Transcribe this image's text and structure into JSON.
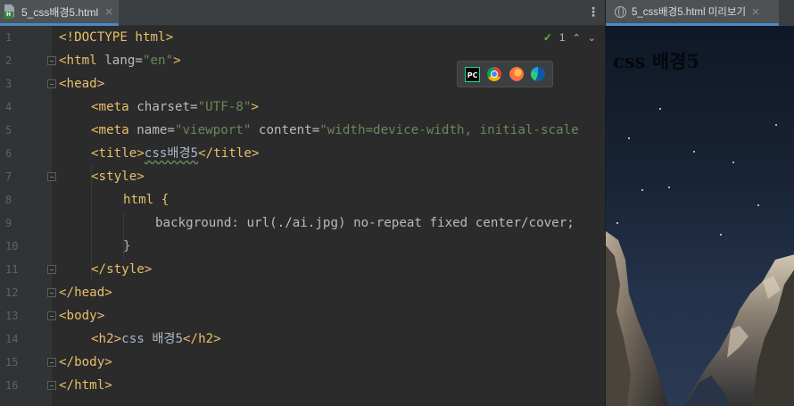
{
  "editor": {
    "tab_label": "5_css배경5.html",
    "file_badge": "H",
    "close_glyph": "×",
    "menu_glyph": "⋮",
    "inspection": {
      "count": "1",
      "up": "⌃",
      "down": "⌄"
    },
    "browsers": [
      "pycharm-icon",
      "chrome-icon",
      "firefox-icon",
      "edge-icon"
    ],
    "pc_label": "PC",
    "line_numbers": [
      "1",
      "2",
      "3",
      "4",
      "5",
      "6",
      "7",
      "8",
      "9",
      "10",
      "11",
      "12",
      "13",
      "14",
      "15",
      "16"
    ],
    "code": {
      "l1": "<!DOCTYPE html>",
      "l2_open": "<html ",
      "l2_attr": "lang=",
      "l2_val": "\"en\"",
      "l2_close": ">",
      "l3": "<head>",
      "l4_open": "<meta ",
      "l4_attr": "charset=",
      "l4_val": "\"UTF-8\"",
      "l4_close": ">",
      "l5_open": "<meta ",
      "l5_attr1": "name=",
      "l5_val1": "\"viewport\"",
      "l5_attr2": " content=",
      "l5_val2": "\"width=device-width, initial-scale",
      "l6_open": "<title>",
      "l6_text": "css배경5",
      "l6_close": "</title>",
      "l7": "<style>",
      "l8": "html {",
      "l9": "background: url(./ai.jpg) no-repeat fixed center/cover;",
      "l10": "}",
      "l11": "</style>",
      "l12": "</head>",
      "l13": "<body>",
      "l14_open": "<h2>",
      "l14_text": "css 배경5",
      "l14_close": "</h2>",
      "l15": "</body>",
      "l16": "</html>"
    }
  },
  "preview": {
    "tab_label": "5_css배경5.html 미리보기",
    "close_glyph": "×",
    "heading": "css 배경5"
  },
  "colors": {
    "tag": "#e8bf6a",
    "string": "#6a8759",
    "text": "#a9b7c6",
    "accent": "#4a88c7",
    "check": "#62b543"
  }
}
